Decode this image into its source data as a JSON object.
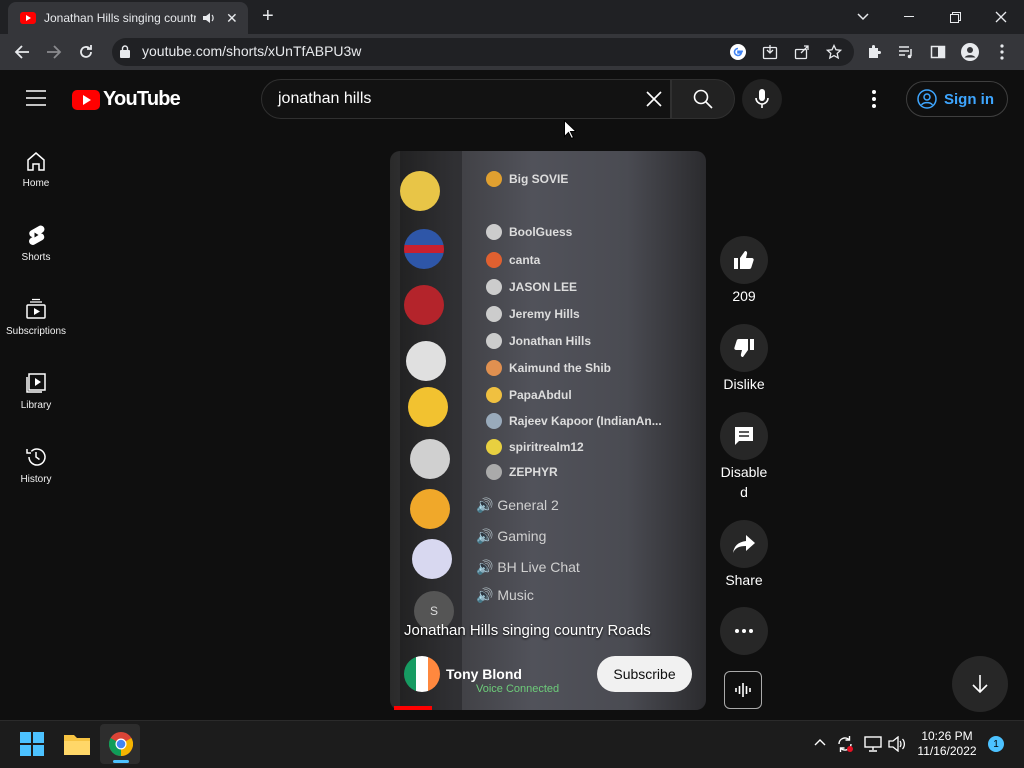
{
  "browser": {
    "tab_title": "Jonathan Hills singing country Roads",
    "new_tab": "+",
    "url": "youtube.com/shorts/xUnTfABPU3w"
  },
  "youtube": {
    "logo_text": "YouTube",
    "search": {
      "value": "jonathan hills",
      "placeholder": "Search"
    },
    "sign_in": "Sign in"
  },
  "sidebar": {
    "items": [
      {
        "label": "Home",
        "icon": "home-icon"
      },
      {
        "label": "Shorts",
        "icon": "shorts-icon"
      },
      {
        "label": "Subscriptions",
        "icon": "subscriptions-icon"
      },
      {
        "label": "Library",
        "icon": "library-icon"
      },
      {
        "label": "History",
        "icon": "history-icon"
      }
    ]
  },
  "video": {
    "title": "Jonathan Hills singing country Roads",
    "channel": "Tony Blond",
    "subscribe": "Subscribe",
    "progress_fraction": 0.12,
    "content": {
      "members": [
        "Big SOVIE",
        "BoolGuess",
        "canta",
        "JASON LEE",
        "Jeremy Hills",
        "Jonathan Hills",
        "Kaimund the Shib",
        "PapaAbdul",
        "Rajeev Kapoor (IndianAn...",
        "spiritrealm12",
        "ZEPHYR"
      ],
      "channels": [
        "General 2",
        "Gaming",
        "BH Live Chat",
        "Music"
      ],
      "server_initial": "S",
      "voice_status": "Voice Connected"
    }
  },
  "actions": {
    "likes": "209",
    "dislike": "Dislike",
    "comments": "Disabled",
    "share": "Share"
  },
  "taskbar": {
    "time": "10:26 PM",
    "date": "11/16/2022",
    "notifications": "1"
  }
}
